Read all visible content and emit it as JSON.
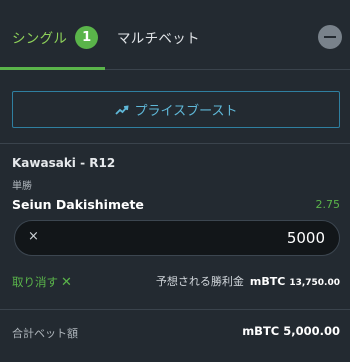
{
  "tabs": {
    "single_label": "シングル",
    "single_count": "1",
    "multi_label": "マルチベット"
  },
  "boost": {
    "label": "プライスブースト",
    "icon": "trending-up-icon"
  },
  "bet": {
    "race": "Kawasaki - R12",
    "market": "単勝",
    "selection": "Seiun Dakishimete",
    "odds": "2.75",
    "stake_clear": "×",
    "stake": "5000",
    "remove_label": "取り消す",
    "remove_icon": "✕",
    "potential_label": "予想される勝利金",
    "potential_currency": "mBTC",
    "potential_value": "13,750.00"
  },
  "footer": {
    "total_label": "合計ベット額",
    "total_value": "mBTC 5,000.00"
  },
  "colors": {
    "accent_green": "#5ab44a",
    "boost_blue": "#5fb8d8",
    "background": "#232a31"
  }
}
